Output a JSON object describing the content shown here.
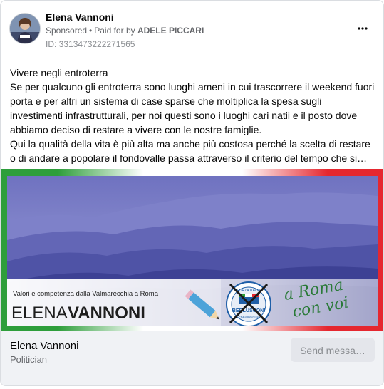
{
  "advertiser": {
    "name": "Elena Vannoni",
    "sponsored_label": "Sponsored",
    "separator": "•",
    "paid_for_label": "Paid for by",
    "payer": "ADELE PICCARI",
    "library_id": "ID: 3313473222271565"
  },
  "post": {
    "lines": [
      "Vivere negli entroterra",
      "Se per qualcuno gli entroterra sono luoghi ameni in cui trascorrere il weekend fuori porta e per altri un sistema di case sparse che moltiplica la spesa sugli investimenti infrastrutturali, per noi questi sono i luoghi cari natii e il posto dove abbiamo deciso di restare a vivere con le nostre famiglie.",
      "Qui la qualità della vita è più alta ma anche più costosa perché la scelta di restare o di andare a popolare il fondovalle passa attraverso il criterio del tempo che si…"
    ]
  },
  "creative": {
    "tagline": "Valori e competenza dalla Valmarecchia a Roma",
    "first_name": "ELENA",
    "last_name": "VANNONI",
    "slogan_line1": "a Roma",
    "slogan_line2": "con voi",
    "logo_top": "FORZA ITALIA",
    "logo_name": "BERLUSCONI",
    "logo_sub": "PRESIDENTE",
    "colors": {
      "sky": "#8c8fcf",
      "hills": "#4b4f9e",
      "green": "#2e9e3b",
      "red": "#e5272f",
      "slogan": "#2a7a38"
    }
  },
  "footer": {
    "page_name": "Elena Vannoni",
    "category": "Politician",
    "cta_label": "Send messa…"
  },
  "icons": {
    "more": "more-horizontal-icon",
    "pencil": "pencil-icon"
  }
}
